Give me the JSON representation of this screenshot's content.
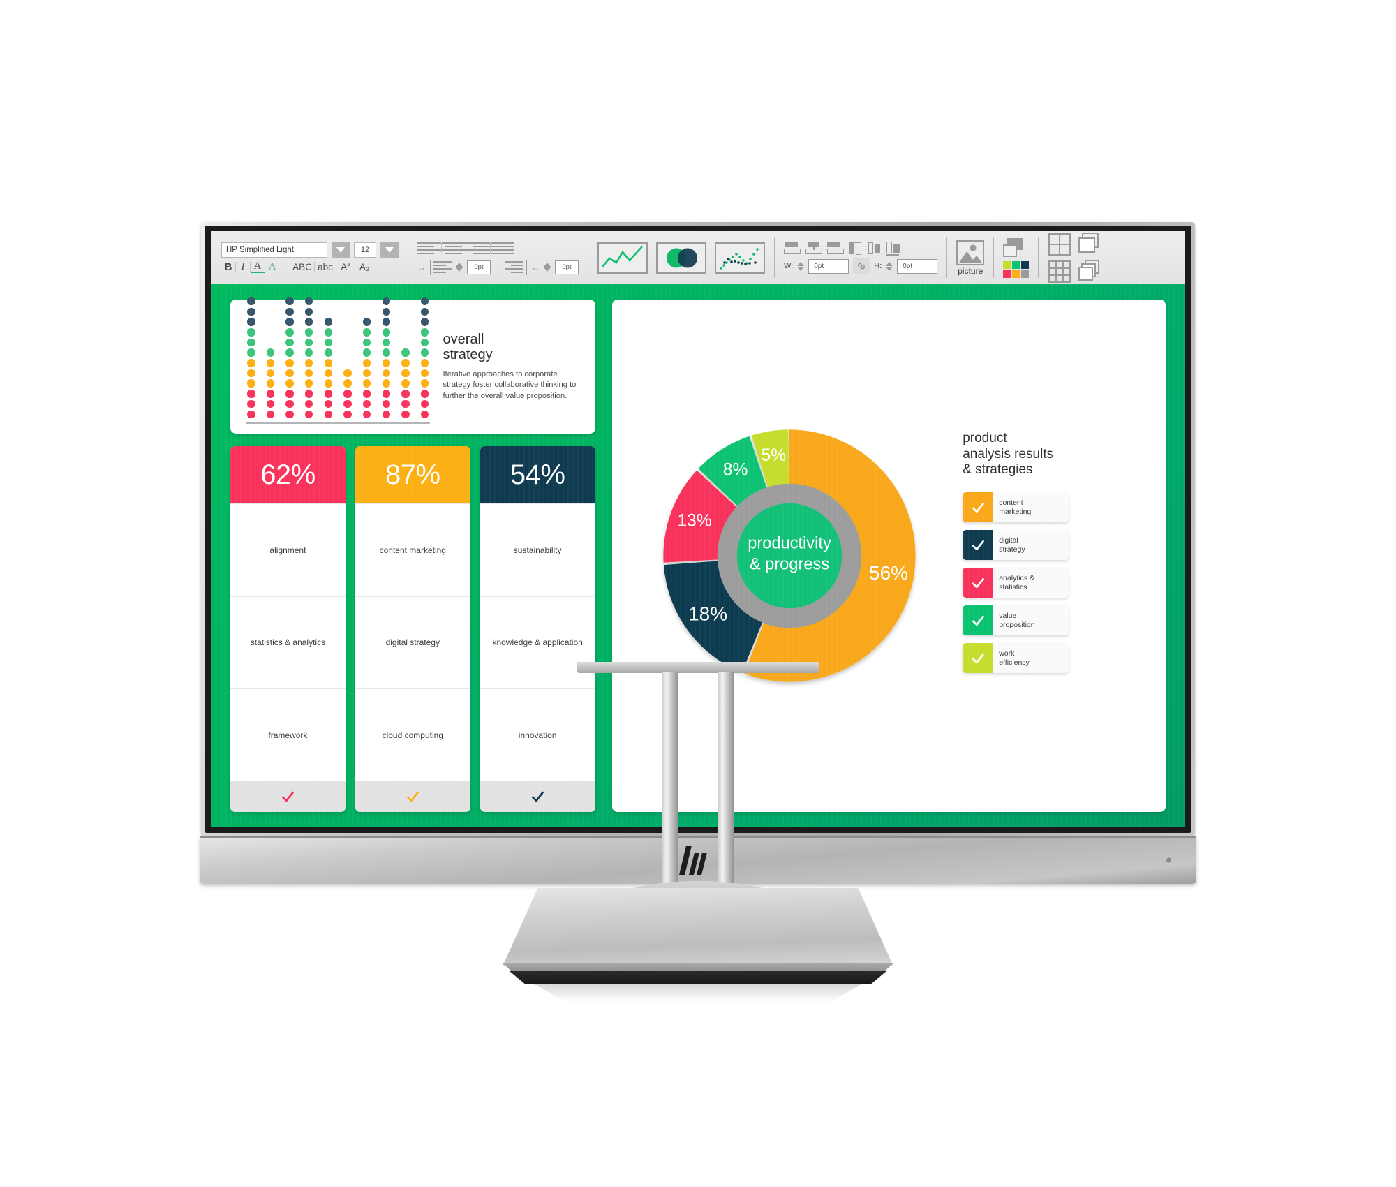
{
  "app": {
    "device": "hp-monitor",
    "brand_mark": "hp-logo"
  },
  "toolbar": {
    "font": {
      "value": "HP Simplified Light",
      "dropdown_icon": "chevron-down-icon"
    },
    "font_size": {
      "value": "12",
      "dropdown_icon": "chevron-down-icon"
    },
    "format_buttons": [
      {
        "name": "bold",
        "label": "B"
      },
      {
        "name": "italic",
        "label": "I"
      },
      {
        "name": "underline",
        "label": "A"
      },
      {
        "name": "text-color",
        "label": "A"
      },
      {
        "name": "uppercase",
        "label": "ABC"
      },
      {
        "name": "lowercase",
        "label": "abc"
      },
      {
        "name": "superscript",
        "label": "A²"
      },
      {
        "name": "subscript",
        "label": "A₂"
      }
    ],
    "align_buttons": [
      "align-left",
      "align-center",
      "align-right",
      "align-justify"
    ],
    "indent": {
      "increase_label": "0pt",
      "decrease_label": "0pt"
    },
    "charts": [
      "line-chart-icon",
      "venn-chart-icon",
      "scatter-chart-icon"
    ],
    "size": {
      "width_label": "W:",
      "width_value": "0pt",
      "height_label": "H:",
      "height_value": "0pt",
      "link_icon": "link-icon"
    },
    "picture": {
      "label": "picture",
      "icon": "picture-icon"
    },
    "shapes_icon": "shapes-icon",
    "palette_icon": "color-palette-icon",
    "table_icons": [
      "table-2x2-icon",
      "table-3x3-icon",
      "copy-icon",
      "duplicate-icon"
    ]
  },
  "slide": {
    "overall_strategy": {
      "title_line1": "overall",
      "title_line2": "strategy",
      "body": "Iterative approaches to corporate strategy foster collaborative thinking to further the overall value proposition."
    },
    "percent_cards": [
      {
        "value": "62%",
        "color": "#f8325a",
        "rows": [
          "alignment",
          "statistics & analytics",
          "framework"
        ],
        "check": "check-icon"
      },
      {
        "value": "87%",
        "color": "#fcb013",
        "rows": [
          "content marketing",
          "digital strategy",
          "cloud computing"
        ],
        "check": "check-icon"
      },
      {
        "value": "54%",
        "color": "#0f3a4f",
        "rows": [
          "sustainability",
          "knowledge & application",
          "innovation"
        ],
        "check": "check-icon"
      }
    ],
    "donut_panel": {
      "title_line1": "product",
      "title_line2": "analysis results",
      "title_line3": "& strategies",
      "center_line1": "productivity",
      "center_line2": "& progress",
      "legend": [
        {
          "label_line1": "content",
          "label_line2": "marketing",
          "color": "#f9a81a"
        },
        {
          "label_line1": "digital",
          "label_line2": "strategy",
          "color": "#0f3a4f"
        },
        {
          "label_line1": "analytics &",
          "label_line2": "statistics",
          "color": "#f8325a"
        },
        {
          "label_line1": "value",
          "label_line2": "proposition",
          "color": "#0bc270"
        },
        {
          "label_line1": "work",
          "label_line2": "efficiency",
          "color": "#c7dd2e"
        }
      ]
    }
  },
  "chart_data": [
    {
      "type": "pie",
      "title": "product analysis results & strategies",
      "center_label": "productivity & progress",
      "categories": [
        "content marketing",
        "digital strategy",
        "analytics & statistics",
        "value proposition",
        "work efficiency"
      ],
      "values": [
        56,
        18,
        13,
        8,
        5
      ],
      "value_labels": [
        "56%",
        "18%",
        "13%",
        "8%",
        "5%"
      ],
      "colors": [
        "#f9a81a",
        "#0f3a4f",
        "#f8325a",
        "#0bc270",
        "#c7dd2e"
      ],
      "donut": true,
      "legend_position": "right"
    },
    {
      "type": "bar",
      "title": "overall strategy",
      "subtitle": "dot-matrix column chart",
      "categories": [
        "1",
        "2",
        "3",
        "4",
        "5",
        "6",
        "7",
        "8",
        "9",
        "10"
      ],
      "values": [
        12,
        7,
        12,
        12,
        10,
        5,
        10,
        12,
        7,
        12
      ],
      "unit": "dots",
      "ylim": [
        0,
        12
      ],
      "grid": false,
      "segment_colors": [
        "#f8325a",
        "#fcb013",
        "#3cc47c",
        "#38566b"
      ],
      "segment_sizes": [
        3,
        3,
        3,
        3
      ],
      "xlabel": "",
      "ylabel": ""
    },
    {
      "type": "bar",
      "title": "key metrics",
      "categories": [
        "alignment / statistics & analytics / framework",
        "content marketing / digital strategy / cloud computing",
        "sustainability / knowledge & application / innovation"
      ],
      "values": [
        62,
        87,
        54
      ],
      "value_labels": [
        "62%",
        "87%",
        "54%"
      ],
      "colors": [
        "#f8325a",
        "#fcb013",
        "#0f3a4f"
      ],
      "ylim": [
        0,
        100
      ]
    }
  ]
}
